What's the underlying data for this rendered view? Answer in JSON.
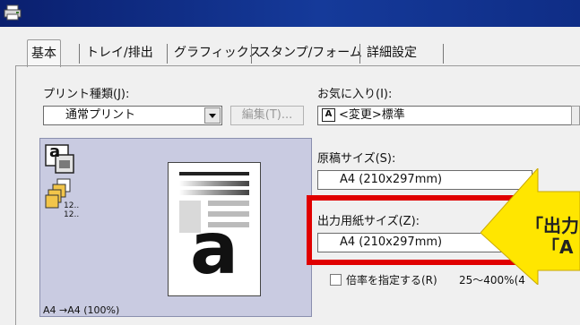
{
  "tabs": [
    "基本",
    "トレイ/排出",
    "グラフィックス",
    "スタンプ/フォーム",
    "詳細設定"
  ],
  "print_type": {
    "label": "プリント種類(J):",
    "value": "通常プリント",
    "edit_button": "編集(T)..."
  },
  "favorites": {
    "label": "お気に入り(I):",
    "value": "<変更>標準",
    "icon_letter": "A"
  },
  "original_size": {
    "label": "原稿サイズ(S):",
    "value": "A4 (210x297mm)"
  },
  "output_size": {
    "label": "出力用紙サイズ(Z):",
    "value": "A4 (210x297mm)"
  },
  "scale": {
    "label": "倍率を指定する(R)",
    "range": "25～400%(4"
  },
  "preview": {
    "status": "A4 →A4 (100%)",
    "big_letter": "a",
    "icon_a": "a",
    "stack_text_1": "12..",
    "stack_text_2": "12.."
  },
  "callout": {
    "line1": "「出力",
    "line2": "「A"
  },
  "colors": {
    "titlebar": "#0a1f6e",
    "highlight_border": "#e00000",
    "callout_fill": "#ffe600"
  }
}
